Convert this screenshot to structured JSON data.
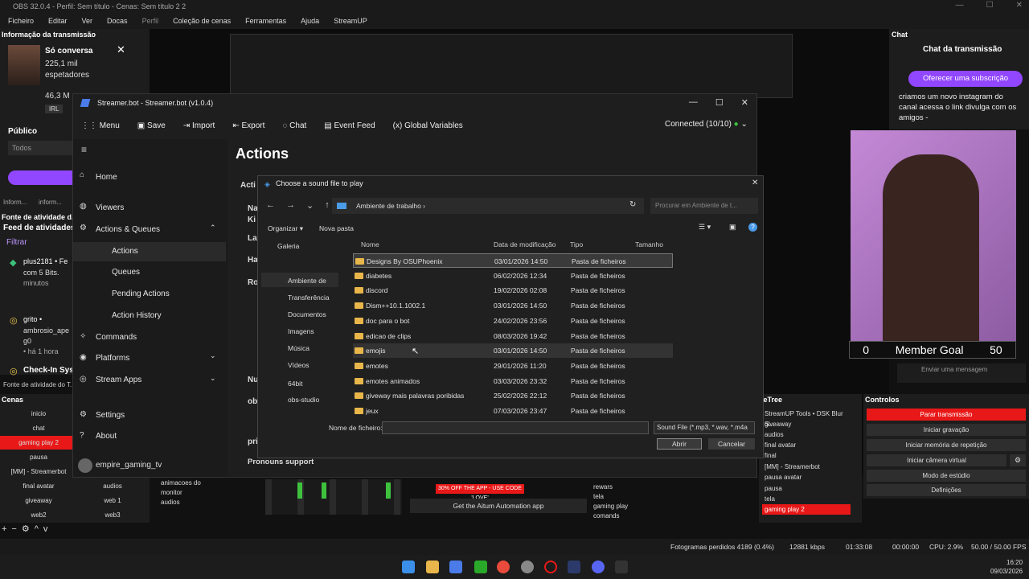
{
  "obs": {
    "title": "OBS 32.0.4 - Perfil: Sem título - Cenas: Sem título 2 2",
    "menu": [
      "Ficheiro",
      "Editar",
      "Ver",
      "Docas",
      "Perfil",
      "Coleção de cenas",
      "Ferramentas",
      "Ajuda",
      "StreamUP"
    ],
    "info_dock": {
      "title": "Informação da transmissão",
      "line1": "Só conversa",
      "line2": "225,1 mil",
      "line3": "espetadores",
      "stat": "46,3 M",
      "irl": "IRL"
    },
    "publico": "Público",
    "todos": "Todos",
    "tab1": "Inform...",
    "tab2": "inform...",
    "activity_dock": "Fonte de atividade d...",
    "feed_title": "Feed de atividades",
    "filtrar": "Filtrar",
    "feed1": {
      "user": "plus2181",
      "line1": "• Fe",
      "line2": "com 5 Bits.",
      "line3": "minutos"
    },
    "feed2": {
      "user": "grito",
      "line1": "•",
      "line2": "ambrosio_ape",
      "line3": "g0",
      "line4": "• há 1 hora"
    },
    "checkin": "Check-In Sys",
    "activity_footer": "Fonte de atividade do T...",
    "scenes_hdr": "Cenas",
    "scenes": [
      "inicio",
      "chat",
      "gaming play 2",
      "pausa",
      "[MM] - Streamerbot",
      "final avatar",
      "giveaway",
      "web2"
    ],
    "sources": [
      "",
      "",
      "",
      "",
      "",
      "audios",
      "web 1",
      "web3"
    ],
    "mixer_sources": [
      "animacoes do",
      "monitor",
      "audios"
    ],
    "ad": "30% OFF THE APP - USE CODE 'LOVE'",
    "aitum": "Get the Aitum Automation app",
    "chat_list": [
      "rewars",
      "tela",
      "gaming play",
      "comands"
    ],
    "chat_hdr": "Chat",
    "chat_title": "Chat da transmissão",
    "chat_sub": "Oferecer uma subscrição",
    "chat_msg": "criamos um novo instagram do canal acessa o link divulga com os amigos -",
    "member_goal": {
      "left": "0",
      "label": "Member Goal",
      "right": "50"
    },
    "send_msg": "Enviar uma mensagem",
    "tree_hdr": "neTree",
    "tree": [
      "StreamUP Tools • DSK Blur S...",
      "giveaway",
      "audios",
      "final avatar",
      "final",
      "[MM] - Streamerbot",
      "pausa avatar",
      "pausa",
      "tela",
      "gaming play 2"
    ],
    "controls_hdr": "Controlos",
    "controls": [
      "Parar transmissão",
      "Iniciar gravação",
      "Iniciar memória de repetição",
      "Iniciar câmera virtual",
      "Modo de estúdio",
      "Definições"
    ],
    "status": {
      "dropped": "Fotogramas perdidos 4189 (0.4%)",
      "kbps": "12881 kbps",
      "time1": "01:33:08",
      "time2": "00:00:00",
      "cpu": "CPU: 2.9%",
      "fps": "50.00 / 50.00 FPS"
    },
    "clock": {
      "time": "16:20",
      "date": "09/03/2026"
    }
  },
  "streamerbot": {
    "title": "Streamer.bot - Streamer.bot (v1.0.4)",
    "toolbar": [
      "Menu",
      "Save",
      "Import",
      "Export",
      "Chat",
      "Event Feed",
      "Global Variables"
    ],
    "connected": "Connected (10/10)",
    "page_title": "Actions",
    "nav": [
      {
        "label": "Home",
        "icon": "home-icon"
      },
      {
        "label": "Viewers",
        "icon": "person-icon"
      },
      {
        "label": "Actions & Queues",
        "icon": "gear-icon"
      },
      {
        "label": "Actions",
        "icon": "brush-icon"
      },
      {
        "label": "Queues",
        "icon": "list-icon"
      },
      {
        "label": "Pending Actions",
        "icon": "clock-icon"
      },
      {
        "label": "Action History",
        "icon": "history-icon"
      },
      {
        "label": "Commands",
        "icon": "command-icon"
      },
      {
        "label": "Platforms",
        "icon": "platforms-icon"
      },
      {
        "label": "Stream Apps",
        "icon": "apps-icon"
      },
      {
        "label": "Settings",
        "icon": "gear-icon"
      },
      {
        "label": "About",
        "icon": "help-icon"
      }
    ],
    "user": "empire_gaming_tv",
    "bg_fragments": [
      "Acti",
      "Na",
      "Ki",
      "La",
      "Ha",
      "Ro",
      "Nu",
      "obs",
      "pri"
    ],
    "pronouns": "Pronouns support"
  },
  "dialog": {
    "title": "Choose a sound file to play",
    "path": "Ambiente de trabalho",
    "search_placeholder": "Procurar em Ambiente de t...",
    "organize": "Organizar",
    "new_folder": "Nova pasta",
    "nav": [
      "Galeria",
      "Ambiente de",
      "Transferência",
      "Documentos",
      "Imagens",
      "Música",
      "Vídeos",
      "64bit",
      "obs-studio"
    ],
    "columns": [
      "Nome",
      "Data de modificação",
      "Tipo",
      "Tamanho"
    ],
    "rows": [
      {
        "name": "Designs By OSUPhoenix",
        "date": "03/01/2026 14:50",
        "type": "Pasta de ficheiros"
      },
      {
        "name": "diabetes",
        "date": "06/02/2026 12:34",
        "type": "Pasta de ficheiros"
      },
      {
        "name": "discord",
        "date": "19/02/2026 02:08",
        "type": "Pasta de ficheiros"
      },
      {
        "name": "Dism++10.1.1002.1",
        "date": "03/01/2026 14:50",
        "type": "Pasta de ficheiros"
      },
      {
        "name": "doc para o bot",
        "date": "24/02/2026 23:56",
        "type": "Pasta de ficheiros"
      },
      {
        "name": "edicao de clips",
        "date": "08/03/2026 19:42",
        "type": "Pasta de ficheiros"
      },
      {
        "name": "emojis",
        "date": "03/01/2026 14:50",
        "type": "Pasta de ficheiros"
      },
      {
        "name": "emotes",
        "date": "29/01/2026 11:20",
        "type": "Pasta de ficheiros"
      },
      {
        "name": "emotes animados",
        "date": "03/03/2026 23:32",
        "type": "Pasta de ficheiros"
      },
      {
        "name": "giveway mais palavras poribidas",
        "date": "25/02/2026 22:12",
        "type": "Pasta de ficheiros"
      },
      {
        "name": "jeux",
        "date": "07/03/2026 23:47",
        "type": "Pasta de ficheiros"
      }
    ],
    "filename_label": "Nome de ficheiro:",
    "filter": "Sound File (*.mp3, *.wav, *.m4a",
    "open": "Abrir",
    "cancel": "Cancelar"
  },
  "colors": {
    "obs_red": "#e81818",
    "twitch_purple": "#9146ff",
    "accent": "#7c5cff"
  }
}
